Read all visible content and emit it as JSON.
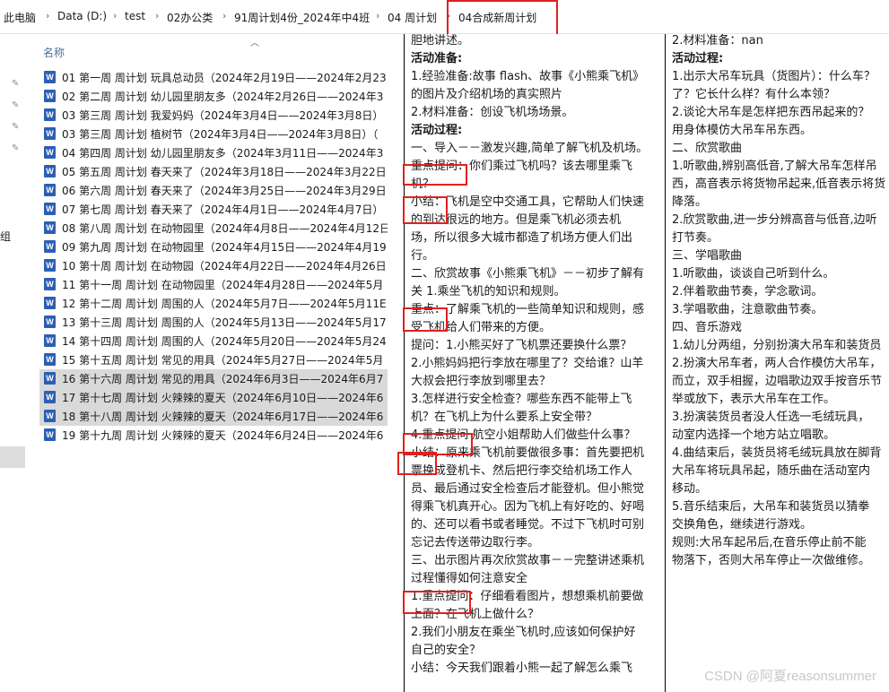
{
  "breadcrumb": [
    "此电脑",
    "Data (D:)",
    "test",
    "02办公类",
    "91周计划4份_2024年中4班",
    "04 周计划",
    "04合成新周计划"
  ],
  "side_label": "组",
  "file_list": {
    "column_header": "名称",
    "files": [
      {
        "name": "01 第一周 周计划 玩具总动员（2024年2月19日——2024年2月23",
        "selected": false
      },
      {
        "name": "02 第二周 周计划 幼儿园里朋友多（2024年2月26日——2024年3",
        "selected": false
      },
      {
        "name": "03 第三周 周计划 我爱妈妈（2024年3月4日——2024年3月8日）",
        "selected": false
      },
      {
        "name": "03 第三周 周计划 植树节（2024年3月4日——2024年3月8日）（",
        "selected": false
      },
      {
        "name": "04 第四周 周计划 幼儿园里朋友多（2024年3月11日——2024年3",
        "selected": false
      },
      {
        "name": "05 第五周 周计划 春天来了（2024年3月18日——2024年3月22日",
        "selected": false
      },
      {
        "name": "06 第六周 周计划 春天来了（2024年3月25日——2024年3月29日",
        "selected": false
      },
      {
        "name": "07 第七周 周计划 春天来了（2024年4月1日——2024年4月7日）",
        "selected": false
      },
      {
        "name": "08 第八周 周计划 在动物园里（2024年4月8日——2024年4月12日",
        "selected": false
      },
      {
        "name": "09 第九周 周计划 在动物园里（2024年4月15日——2024年4月19",
        "selected": false
      },
      {
        "name": "10 第十周 周计划 在动物园（2024年4月22日——2024年4月26日",
        "selected": false
      },
      {
        "name": "11 第十一周 周计划 在动物园里（2024年4月28日——2024年5月",
        "selected": false
      },
      {
        "name": "12 第十二周 周计划 周围的人（2024年5月7日——2024年5月11E",
        "selected": false
      },
      {
        "name": "13 第十三周 周计划 周围的人（2024年5月13日——2024年5月17",
        "selected": false
      },
      {
        "name": "14 第十四周 周计划 周围的人（2024年5月20日——2024年5月24",
        "selected": false
      },
      {
        "name": "15 第十五周 周计划 常见的用具（2024年5月27日——2024年5月",
        "selected": false
      },
      {
        "name": "16 第十六周 周计划 常见的用具（2024年6月3日——2024年6月7",
        "selected": true
      },
      {
        "name": "17 第十七周 周计划 火辣辣的夏天（2024年6月10日——2024年6",
        "selected": true
      },
      {
        "name": "18 第十八周 周计划 火辣辣的夏天（2024年6月17日——2024年6",
        "selected": true
      },
      {
        "name": "19 第十九周 周计划 火辣辣的夏天（2024年6月24日——2024年6",
        "selected": false
      }
    ]
  },
  "document": {
    "col1_lines": [
      {
        "text": "胆地讲述。",
        "bold": false
      },
      {
        "text": "活动准备:",
        "bold": true
      },
      {
        "text": "1.经验准备:故事 flash、故事《小熊乘飞机》",
        "bold": false
      },
      {
        "text": "的图片及介绍机场的真实照片",
        "bold": false
      },
      {
        "text": "2.材料准备：创设飞机场场景。",
        "bold": false
      },
      {
        "text": "活动过程:",
        "bold": true
      },
      {
        "text": "一、导入－－激发兴趣,简单了解飞机及机场。",
        "bold": false
      },
      {
        "text": "重点提问：你们乘过飞机吗？该去哪里乘飞",
        "bold": false
      },
      {
        "text": "机？",
        "bold": false
      },
      {
        "text": "小结：飞机是空中交通工具，它帮助人们快速",
        "bold": false
      },
      {
        "text": "的到达很远的地方。但是乘飞机必须去机",
        "bold": false
      },
      {
        "text": "场，所以很多大城市都造了机场方便人们出",
        "bold": false
      },
      {
        "text": "行。",
        "bold": false
      },
      {
        "text": "二、欣赏故事《小熊乘飞机》－－初步了解有",
        "bold": false
      },
      {
        "text": "关 1.乘坐飞机的知识和规则。",
        "bold": false
      },
      {
        "text": "重点：了解乘飞机的一些简单知识和规则，感",
        "bold": false
      },
      {
        "text": "受飞机给人们带来的方便。",
        "bold": false
      },
      {
        "text": "提问：1.小熊买好了飞机票还要换什么票？",
        "bold": false
      },
      {
        "text": "2.小熊妈妈把行李放在哪里了？交给谁？山羊",
        "bold": false
      },
      {
        "text": "大叔会把行李放到哪里去？",
        "bold": false
      },
      {
        "text": "3.怎样进行安全检查？哪些东西不能带上飞",
        "bold": false
      },
      {
        "text": "机？在飞机上为什么要系上安全带？",
        "bold": false
      },
      {
        "text": "4.重点提问 航空小姐帮助人们做些什么事？",
        "bold": false
      },
      {
        "text": "小结：原来乘飞机前要做很多事：首先要把机",
        "bold": false
      },
      {
        "text": "票换成登机卡、然后把行李交给机场工作人",
        "bold": false
      },
      {
        "text": "员、最后通过安全检查后才能登机。但小熊觉",
        "bold": false
      },
      {
        "text": "得乘飞机真开心。因为飞机上有好吃的、好喝",
        "bold": false
      },
      {
        "text": "的、还可以看书或者睡觉。不过下飞机时可别",
        "bold": false
      },
      {
        "text": "忘记去传送带边取行李。",
        "bold": false
      },
      {
        "text": "三、出示图片再次欣赏故事－－完整讲述乘机",
        "bold": false
      },
      {
        "text": "过程懂得如何注意安全",
        "bold": false
      },
      {
        "text": "1.重点提问：仔细看看图片，想想乘机前要做",
        "bold": false
      },
      {
        "text": "上面？在飞机上做什么？",
        "bold": false
      },
      {
        "text": "2.我们小朋友在乘坐飞机时,应该如何保护好",
        "bold": false
      },
      {
        "text": "自己的安全？",
        "bold": false
      },
      {
        "text": "小结：今天我们跟着小熊一起了解怎么乘飞",
        "bold": false
      }
    ],
    "col2_lines": [
      {
        "text": "2.材料准备：nan",
        "bold": false
      },
      {
        "text": "活动过程:",
        "bold": true
      },
      {
        "text": "1.出示大吊车玩具（货图片）：什么车？",
        "bold": false
      },
      {
        "text": "了？它长什么样？有什么本领？",
        "bold": false
      },
      {
        "text": "2.谈论大吊车是怎样把东西吊起来的？",
        "bold": false
      },
      {
        "text": "用身体模仿大吊车吊东西。",
        "bold": false
      },
      {
        "text": "二、欣赏歌曲",
        "bold": false
      },
      {
        "text": "1.听歌曲,辨别高低音,了解大吊车怎样吊",
        "bold": false
      },
      {
        "text": "西，高音表示将货物吊起来,低音表示将货",
        "bold": false
      },
      {
        "text": "降落。",
        "bold": false
      },
      {
        "text": "2.欣赏歌曲,进一步分辨高音与低音,边听",
        "bold": false
      },
      {
        "text": "打节奏。",
        "bold": false
      },
      {
        "text": "三、学唱歌曲",
        "bold": false
      },
      {
        "text": "1.听歌曲，谈谈自己听到什么。",
        "bold": false
      },
      {
        "text": "2.伴着歌曲节奏，学念歌词。",
        "bold": false
      },
      {
        "text": "3.学唱歌曲，注意歌曲节奏。",
        "bold": false
      },
      {
        "text": "四、音乐游戏",
        "bold": false
      },
      {
        "text": "1.幼儿分两组，分别扮演大吊车和装货员",
        "bold": false
      },
      {
        "text": "2.扮演大吊车者，两人合作模仿大吊车，",
        "bold": false
      },
      {
        "text": "而立，双手相握，边唱歌边双手按音乐节",
        "bold": false
      },
      {
        "text": "举或放下，表示大吊车在工作。",
        "bold": false
      },
      {
        "text": "3.扮演装货员者没人任选一毛绒玩具，",
        "bold": false
      },
      {
        "text": "动室内选择一个地方站立唱歌。",
        "bold": false
      },
      {
        "text": "4.曲结束后，装货员将毛绒玩具放在脚背",
        "bold": false
      },
      {
        "text": "大吊车将玩具吊起，随乐曲在活动室内",
        "bold": false
      },
      {
        "text": "移动。",
        "bold": false
      },
      {
        "text": "5.音乐结束后，大吊车和装货员以猜拳",
        "bold": false
      },
      {
        "text": "交换角色，继续进行游戏。",
        "bold": false
      },
      {
        "text": "规则:大吊车起吊后,在音乐停止前不能",
        "bold": false
      },
      {
        "text": "物落下，否则大吊车停止一次做维修。",
        "bold": false
      }
    ]
  },
  "watermark": "CSDN @阿夏reasonsummer",
  "colors": {
    "highlight": "#e02020",
    "selected_row": "#d9d9d9",
    "word_icon": "#2b5fb4"
  }
}
